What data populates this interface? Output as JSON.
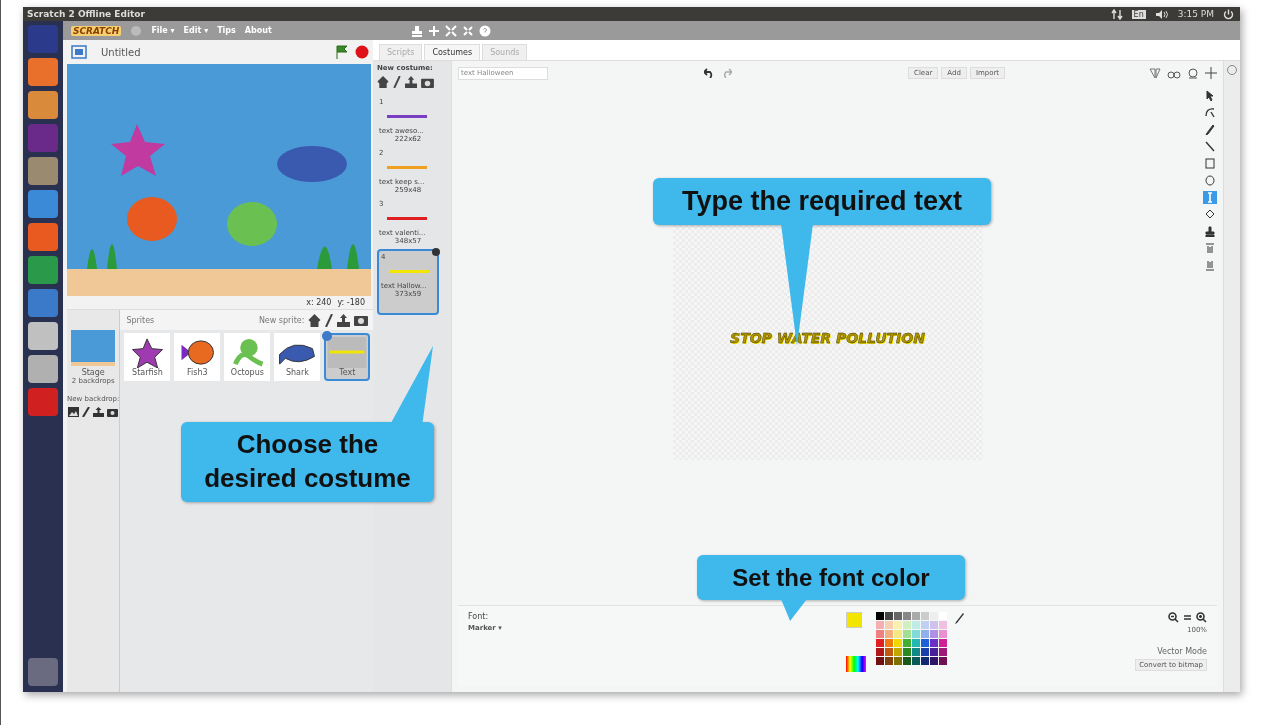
{
  "title_bar": {
    "title": "Scratch 2 Offline Editor",
    "keyboard": "En",
    "time": "3:15 PM"
  },
  "menu": {
    "logo": "SCRATCH",
    "items": [
      "File ▾",
      "Edit ▾",
      "Tips",
      "About"
    ]
  },
  "project": {
    "title": "Untitled"
  },
  "stage": {
    "x": "x: 240",
    "y": "y: -180"
  },
  "sprites_panel": {
    "title": "Sprites",
    "new_sprite": "New sprite:",
    "stage_name": "Stage",
    "stage_sub": "2 backdrops",
    "new_backdrop": "New backdrop:",
    "sprites": [
      {
        "name": "Starfish",
        "kind": "starfish",
        "selected": false
      },
      {
        "name": "Fish3",
        "kind": "fish",
        "selected": false
      },
      {
        "name": "Octopus",
        "kind": "octopus",
        "selected": false
      },
      {
        "name": "Shark",
        "kind": "shark",
        "selected": false
      },
      {
        "name": "Text",
        "kind": "text",
        "selected": true
      }
    ]
  },
  "tabs": [
    {
      "label": "Scripts",
      "selected": false
    },
    {
      "label": "Costumes",
      "selected": true
    },
    {
      "label": "Sounds",
      "selected": false
    }
  ],
  "costumes": {
    "new_costume": "New costume:",
    "items": [
      {
        "number": "1",
        "name": "text aweso...",
        "size": "222x62",
        "color": "#7a3fc0",
        "selected": false
      },
      {
        "number": "2",
        "name": "text keep s...",
        "size": "259x48",
        "color": "#f0a020",
        "selected": false
      },
      {
        "number": "3",
        "name": "text valenti...",
        "size": "348x57",
        "color": "#e02020",
        "selected": false
      },
      {
        "number": "4",
        "name": "text Hallow...",
        "size": "373x59",
        "color": "#f2e600",
        "selected": true
      }
    ]
  },
  "editor": {
    "name_value": "text Halloween",
    "buttons": [
      "Clear",
      "Add",
      "Import"
    ],
    "canvas_text": "STOP WATER POLLUTION",
    "font_label": "Font:",
    "font": "Marker ▾",
    "zoom": "100%",
    "mode": "Vector Mode",
    "convert": "Convert to bitmap",
    "tools": [
      {
        "kind": "select",
        "selected": false
      },
      {
        "kind": "reshape",
        "selected": false
      },
      {
        "kind": "pencil",
        "selected": false
      },
      {
        "kind": "line",
        "selected": false
      },
      {
        "kind": "rect",
        "selected": false
      },
      {
        "kind": "ellipse",
        "selected": false
      },
      {
        "kind": "text",
        "selected": true
      },
      {
        "kind": "fill",
        "selected": false
      },
      {
        "kind": "stamp",
        "selected": false
      },
      {
        "kind": "front",
        "selected": false
      },
      {
        "kind": "back",
        "selected": false
      }
    ]
  },
  "callouts": [
    {
      "text": "Type the required text"
    },
    {
      "text": "Choose the desired costume"
    },
    {
      "text": "Set the font color"
    }
  ]
}
